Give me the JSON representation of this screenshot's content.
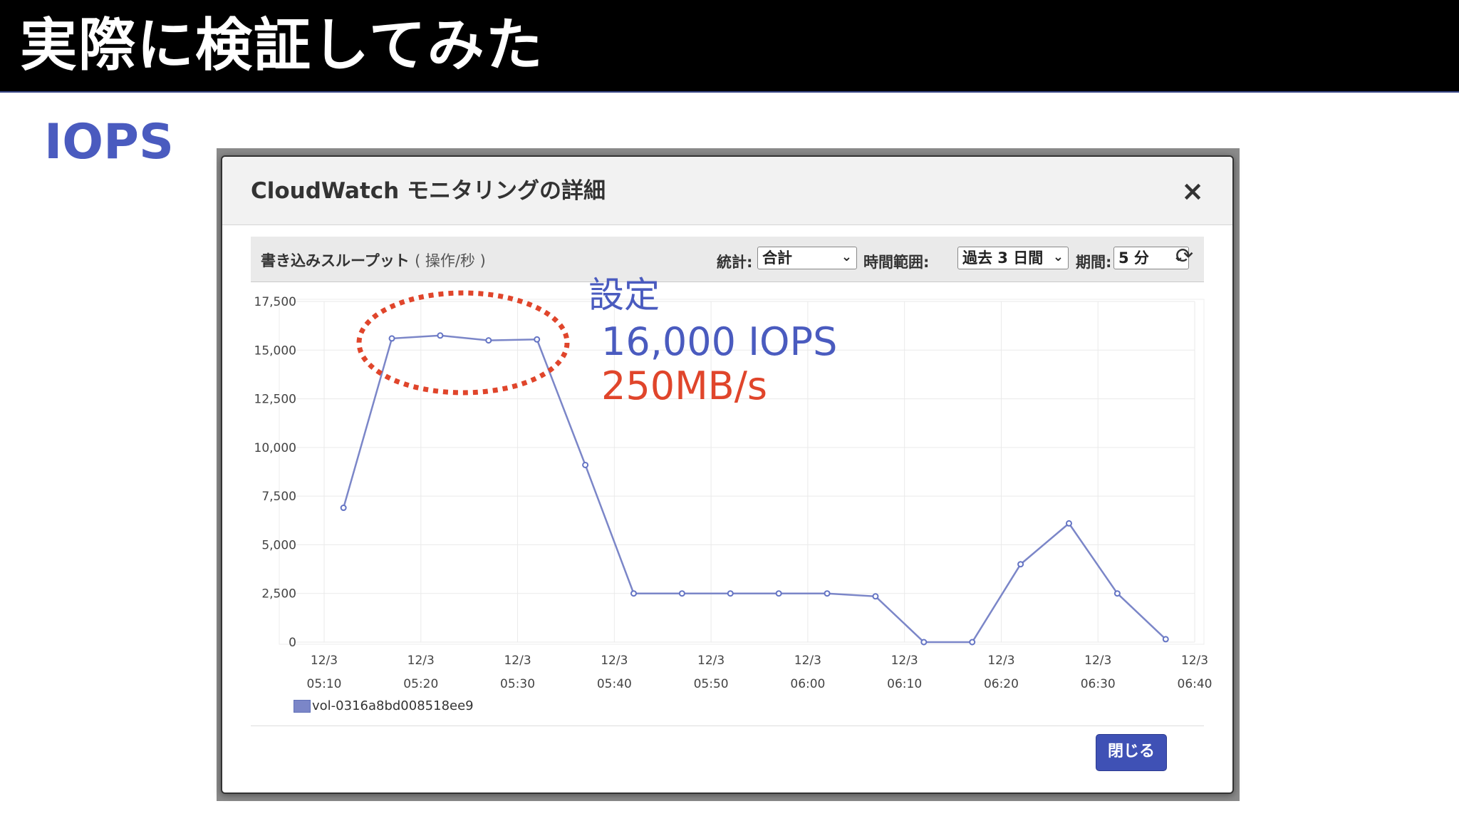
{
  "slide": {
    "title": "実際に検証してみた",
    "section_label": "IOPS"
  },
  "modal": {
    "title": "CloudWatch モニタリングの詳細",
    "close_icon": "×",
    "metric": {
      "name": "書き込みスループット",
      "unit": "( 操作/秒 )"
    },
    "controls": {
      "stat_label": "統計:",
      "stat_value": "合計",
      "range_label": "時間範囲:",
      "range_value": "過去 3 日間",
      "period_label": "期間:",
      "period_value": "5 分",
      "refresh_icon": "refresh-icon"
    },
    "footer_button": "閉じる"
  },
  "annotation": {
    "setting": "設定",
    "iops": "16,000 IOPS",
    "throughput": "250MB/s",
    "iops_color": "#4a5bbf",
    "throughput_color": "#e0452b",
    "ellipse_color": "#e0452b"
  },
  "chart_data": {
    "type": "line",
    "x_ticks": [
      {
        "date": "12/3",
        "time": "05:10"
      },
      {
        "date": "12/3",
        "time": "05:20"
      },
      {
        "date": "12/3",
        "time": "05:30"
      },
      {
        "date": "12/3",
        "time": "05:40"
      },
      {
        "date": "12/3",
        "time": "05:50"
      },
      {
        "date": "12/3",
        "time": "06:00"
      },
      {
        "date": "12/3",
        "time": "06:10"
      },
      {
        "date": "12/3",
        "time": "06:20"
      },
      {
        "date": "12/3",
        "time": "06:30"
      },
      {
        "date": "12/3",
        "time": "06:40"
      }
    ],
    "y_ticks": [
      "0",
      "2,500",
      "5,000",
      "7,500",
      "10,000",
      "12,500",
      "15,000",
      "17,500"
    ],
    "ylim": [
      0,
      17500
    ],
    "series": [
      {
        "name": "vol-0316a8bd008518ee9",
        "color": "#7b86c8",
        "points": [
          {
            "t": "05:12",
            "v": 6900
          },
          {
            "t": "05:17",
            "v": 15600
          },
          {
            "t": "05:22",
            "v": 15750
          },
          {
            "t": "05:27",
            "v": 15500
          },
          {
            "t": "05:32",
            "v": 15550
          },
          {
            "t": "05:37",
            "v": 9100
          },
          {
            "t": "05:42",
            "v": 2500
          },
          {
            "t": "05:47",
            "v": 2500
          },
          {
            "t": "05:52",
            "v": 2500
          },
          {
            "t": "05:57",
            "v": 2500
          },
          {
            "t": "06:02",
            "v": 2500
          },
          {
            "t": "06:07",
            "v": 2350
          },
          {
            "t": "06:12",
            "v": 0
          },
          {
            "t": "06:17",
            "v": 0
          },
          {
            "t": "06:22",
            "v": 4000
          },
          {
            "t": "06:27",
            "v": 6100
          },
          {
            "t": "06:32",
            "v": 2500
          },
          {
            "t": "06:37",
            "v": 150
          }
        ]
      }
    ],
    "grid": true,
    "legend_position": "bottom-left"
  }
}
